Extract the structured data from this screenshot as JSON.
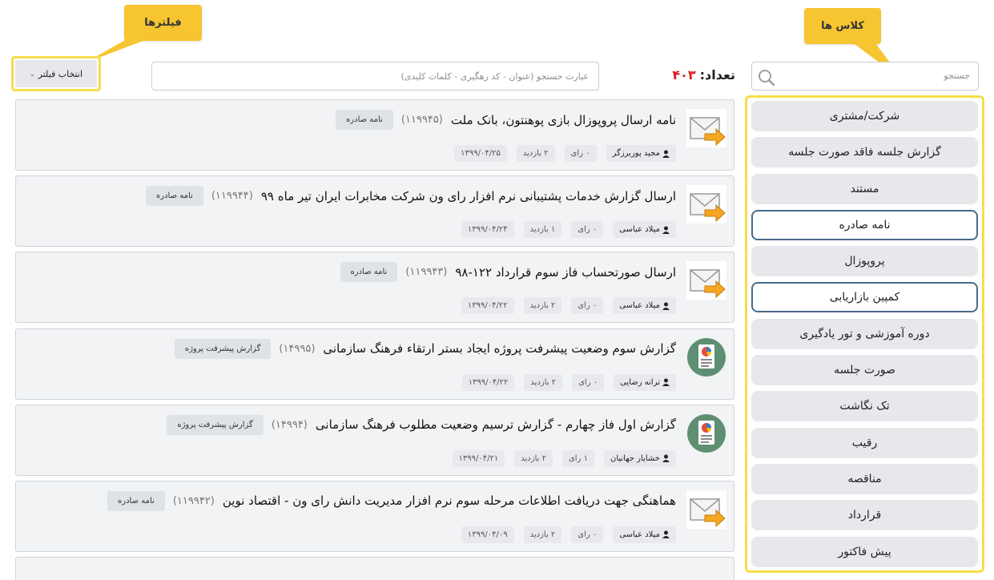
{
  "callouts": {
    "filters": "فیلترها",
    "classes": "کلاس ها"
  },
  "filter_button": {
    "label": "انتخاب فیلتر",
    "icon": "chevron-down-icon"
  },
  "search": {
    "main_placeholder": "عبارت جستجو (عنوان - کد رهگیری - کلمات کلیدی)",
    "side_placeholder": "جستجو"
  },
  "count": {
    "label": "تعداد:",
    "value": "۴۰۳"
  },
  "sidebar": {
    "items": [
      {
        "label": "شرکت/مشتری"
      },
      {
        "label": "گزارش جلسه فاقد صورت جلسه"
      },
      {
        "label": "مستند"
      },
      {
        "label": "نامه صادره"
      },
      {
        "label": "پروپوزال"
      },
      {
        "label": "کمپین بازاریابی"
      },
      {
        "label": "دوره آموزشی و تور یادگیری"
      },
      {
        "label": "صورت جلسه"
      },
      {
        "label": "تک نگاشت"
      },
      {
        "label": "رقیب"
      },
      {
        "label": "مناقصه"
      },
      {
        "label": "قرارداد"
      },
      {
        "label": "پیش فاکتور"
      }
    ]
  },
  "records": [
    {
      "icon": "envelope-arrow-icon",
      "title": "نامه ارسال پروپوزال بازی پوهنتون، بانک ملت",
      "code": "(۱۱۹۹۴۵)",
      "type": "نامه صادره",
      "author": "مجید پوربرزگر",
      "votes": "۰ رای",
      "views": "۲ بازدید",
      "date": "۱۳۹۹/۰۴/۲۵"
    },
    {
      "icon": "envelope-arrow-icon",
      "title": "ارسال گزارش خدمات پشتیبانی نرم افزار رای ون شرکت مخابرات ایران تیر ماه ۹۹",
      "code": "(۱۱۹۹۴۴)",
      "type": "نامه صادره",
      "author": "میلاد عباسی",
      "votes": "۰ رای",
      "views": "۱ بازدید",
      "date": "۱۳۹۹/۰۴/۲۴"
    },
    {
      "icon": "envelope-arrow-icon",
      "title": "ارسال صورتحساب فاز سوم قرارداد ۱۲۲-۹۸",
      "code": "(۱۱۹۹۴۳)",
      "type": "نامه صادره",
      "author": "میلاد عباسی",
      "votes": "۰ رای",
      "views": "۲ بازدید",
      "date": "۱۳۹۹/۰۴/۲۲"
    },
    {
      "icon": "progress-report-icon",
      "title": "گزارش سوم وضعیت پیشرفت پروژه ایجاد بستر ارتقاء فرهنگ سازمانی",
      "code": "(۱۴۹۹۵)",
      "type": "گزارش پیشرفت پروژه",
      "author": "ترانه رضایی",
      "votes": "۰ رای",
      "views": "۲ بازدید",
      "date": "۱۳۹۹/۰۴/۲۲"
    },
    {
      "icon": "progress-report-icon",
      "title": "گزارش اول فاز چهارم - گزارش ترسیم وضعیت مطلوب فرهنگ سازمانی",
      "code": "(۱۴۹۹۴)",
      "type": "گزارش پیشرفت پروژه",
      "author": "خشایار جهانیان",
      "votes": "۱ رای",
      "views": "۲ بازدید",
      "date": "۱۳۹۹/۰۴/۲۱"
    },
    {
      "icon": "envelope-arrow-icon",
      "title": "هماهنگی جهت دریافت اطلاعات مرحله سوم نرم افزار مدیریت دانش رای ون - اقتصاد نوین",
      "code": "(۱۱۹۹۴۲)",
      "type": "نامه صادره",
      "author": "میلاد عباسی",
      "votes": "۰ رای",
      "views": "۲ بازدید",
      "date": "۱۳۹۹/۰۴/۰۹"
    }
  ],
  "colors": {
    "highlight": "#f7dd4a",
    "callout": "#f7c531",
    "count": "#d81b1b",
    "active_border": "#4a6b8c"
  }
}
